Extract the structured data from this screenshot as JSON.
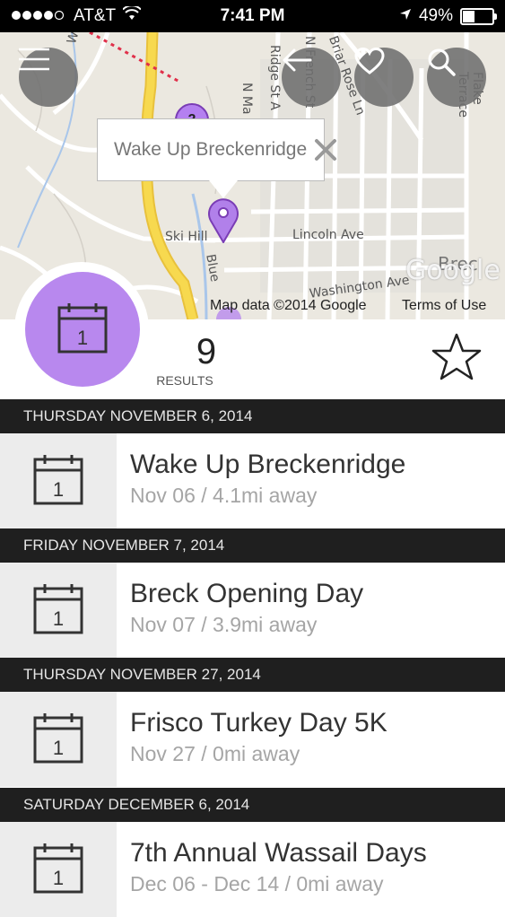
{
  "status_bar": {
    "carrier": "AT&T",
    "time": "7:41 PM",
    "battery": "49%"
  },
  "map": {
    "cluster_count": "2",
    "popup_title": "Wake Up Breckenridge",
    "streets": [
      "Woods",
      "N French St",
      "Briar Rose Ln",
      "Ridge St A",
      "N Ma",
      "Flake Terrace",
      "Ski Hill",
      "Lincoln Ave",
      "Blue",
      "Washington Ave",
      "Brec"
    ],
    "credit": "Map data ©2014 Google",
    "terms": "Terms of Use",
    "logo": "Google"
  },
  "icons": {
    "menu": "menu-icon",
    "back": "back-arrow-icon",
    "favorite": "heart-icon",
    "search": "search-icon",
    "calendar": "calendar-icon",
    "star": "star-icon",
    "close": "close-icon"
  },
  "results": {
    "count": "9",
    "label": "RESULTS"
  },
  "colors": {
    "accent": "#b888ee",
    "header_bg": "#1f1f1f"
  },
  "sections": [
    {
      "header": "THURSDAY NOVEMBER 6, 2014",
      "event": {
        "cal_day": "1",
        "title": "Wake Up Breckenridge",
        "sub": "Nov 06 / 4.1mi away"
      }
    },
    {
      "header": "FRIDAY NOVEMBER 7, 2014",
      "event": {
        "cal_day": "1",
        "title": "Breck Opening Day",
        "sub": "Nov 07 / 3.9mi away"
      }
    },
    {
      "header": "THURSDAY NOVEMBER 27, 2014",
      "event": {
        "cal_day": "1",
        "title": "Frisco Turkey Day 5K",
        "sub": "Nov 27 / 0mi away"
      }
    },
    {
      "header": "SATURDAY DECEMBER 6, 2014",
      "event": {
        "cal_day": "1",
        "title": "7th Annual Wassail Days",
        "sub": "Dec 06 - Dec 14 / 0mi away"
      }
    }
  ]
}
